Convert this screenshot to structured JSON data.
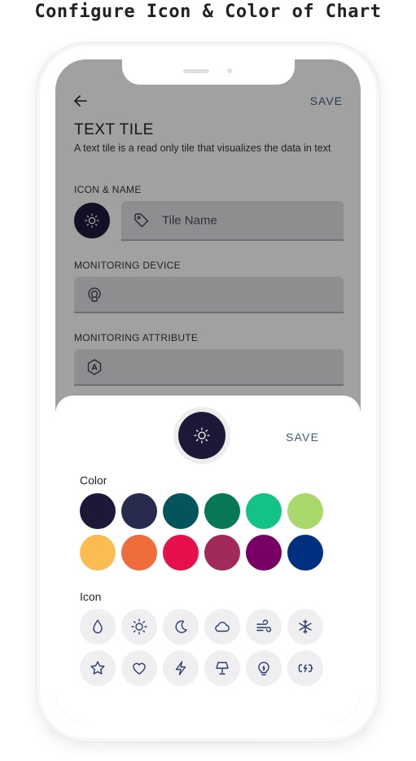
{
  "page_heading": "Configure Icon & Color of Chart",
  "header": {
    "back_icon": "arrow-left-icon",
    "save_label": "SAVE"
  },
  "form": {
    "title": "TEXT TILE",
    "description": "A text tile is a read only tile that visualizes the data in text",
    "icon_name_label": "ICON & NAME",
    "selected_icon": "sun-icon",
    "tile_name_placeholder": "Tile Name",
    "tile_name_icon": "tag-icon",
    "monitoring_device_label": "MONITORING DEVICE",
    "monitoring_device_icon": "device-signal-icon",
    "monitoring_attribute_label": "MONITORING ATTRIBUTE",
    "monitoring_attribute_icon": "attribute-badge-icon"
  },
  "sheet": {
    "save_label": "SAVE",
    "color_label": "Color",
    "icon_label": "Icon",
    "selected_color": "#1b1937",
    "colors": [
      "#1b1937",
      "#282a4e",
      "#03545c",
      "#077855",
      "#13c285",
      "#a9d86c",
      "#fbbd52",
      "#ee6d3a",
      "#e8104a",
      "#a1295c",
      "#780065",
      "#023081"
    ],
    "icons": [
      "drop-icon",
      "sun-icon",
      "moon-icon",
      "cloud-icon",
      "wind-icon",
      "snowflake-icon",
      "star-icon",
      "heart-icon",
      "lightning-icon",
      "lamp-icon",
      "bulb-icon",
      "power-icon"
    ]
  }
}
